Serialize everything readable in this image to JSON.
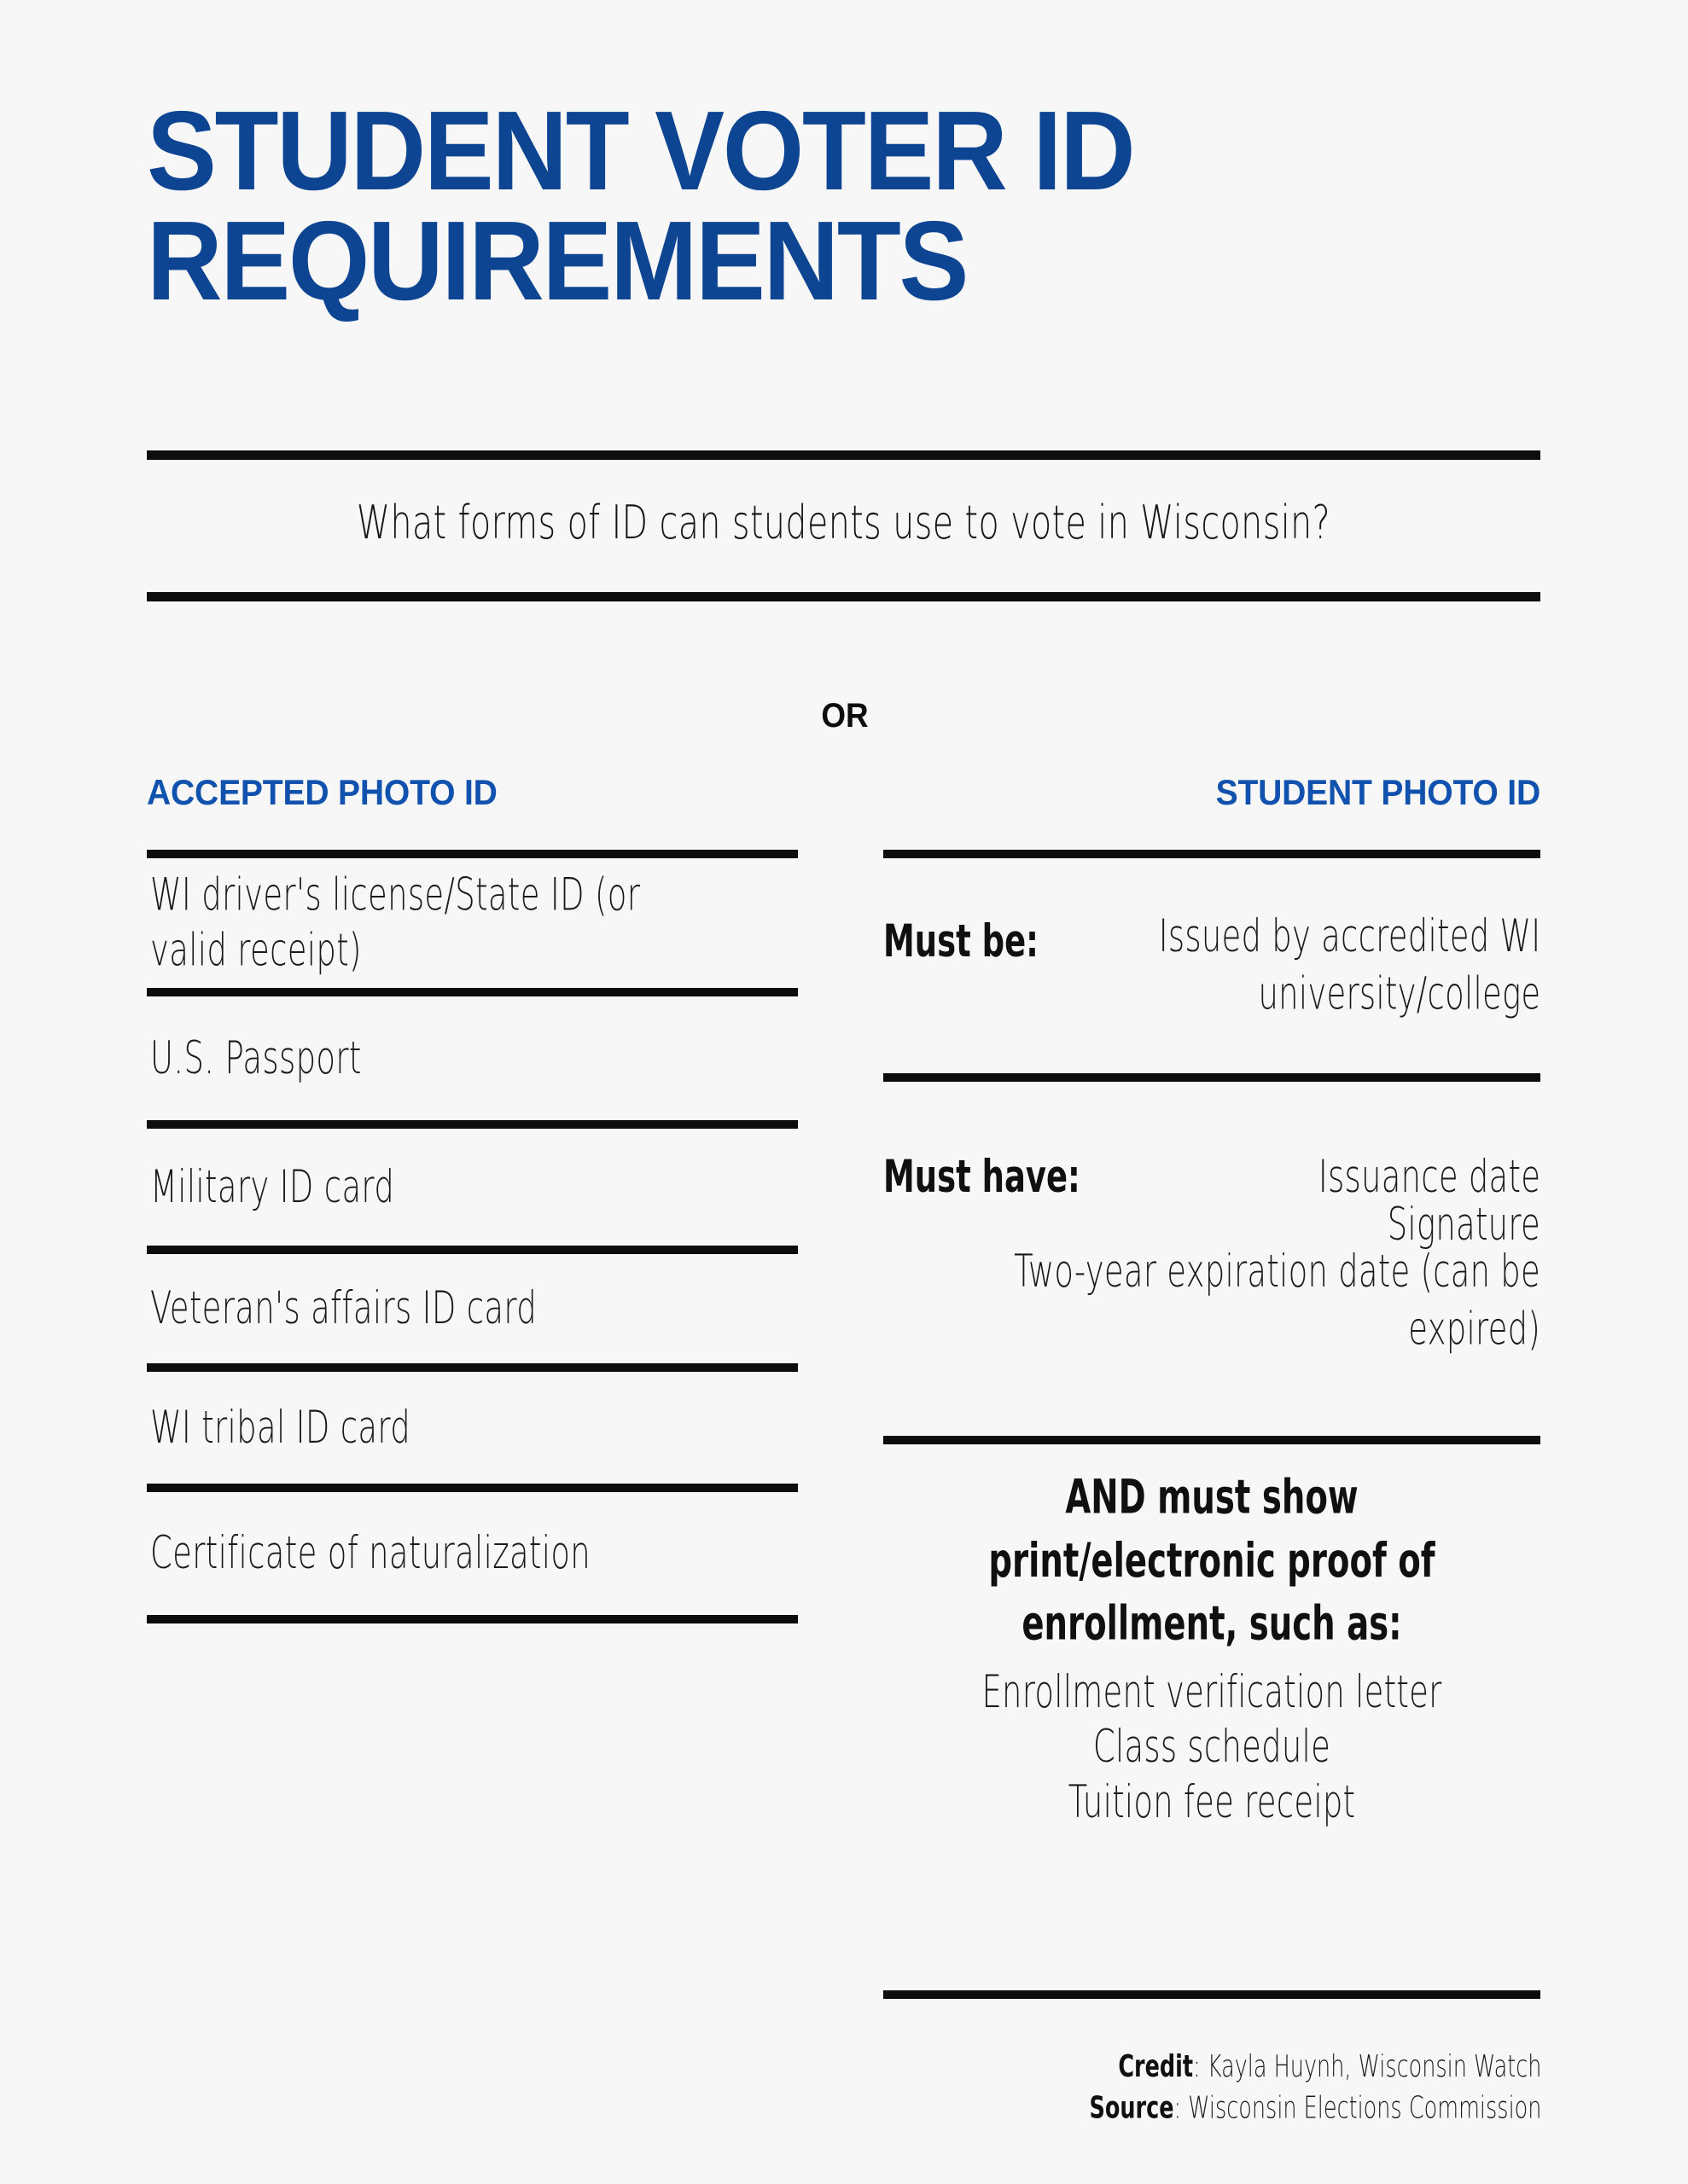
{
  "colors": {
    "background": "#f7f7f7",
    "title_blue": "#0e4593",
    "header_blue": "#1152ae",
    "rule_black": "#0d0d0d",
    "body_text": "#1a1a1a"
  },
  "header": {
    "title": "STUDENT VOTER ID\nREQUIREMENTS",
    "subtitle": "What forms of ID can students use to vote in Wisconsin?"
  },
  "or_label": "OR",
  "left_column": {
    "heading": "ACCEPTED PHOTO ID",
    "items": [
      "WI driver's license/State ID (or valid receipt)",
      "U.S. Passport",
      "Military ID card",
      "Veteran's affairs ID card",
      "WI tribal ID card",
      "Certificate of naturalization"
    ]
  },
  "right_column": {
    "heading": "STUDENT PHOTO ID",
    "must_be": {
      "label": "Must be:",
      "value": "Issued by accredited WI university/college"
    },
    "must_have": {
      "label": "Must have:",
      "values": [
        "Issuance date",
        "Signature",
        "Two-year expiration date (can be expired)"
      ]
    },
    "proof": {
      "statement": "AND must show print/electronic proof of enrollment, such as:",
      "examples": [
        "Enrollment verification letter",
        "Class schedule",
        "Tuition fee receipt"
      ]
    }
  },
  "footer": {
    "credit_label": "Credit",
    "credit_value": ": Kayla Huynh, Wisconsin Watch",
    "source_label": "Source",
    "source_value": ": Wisconsin Elections Commission"
  }
}
